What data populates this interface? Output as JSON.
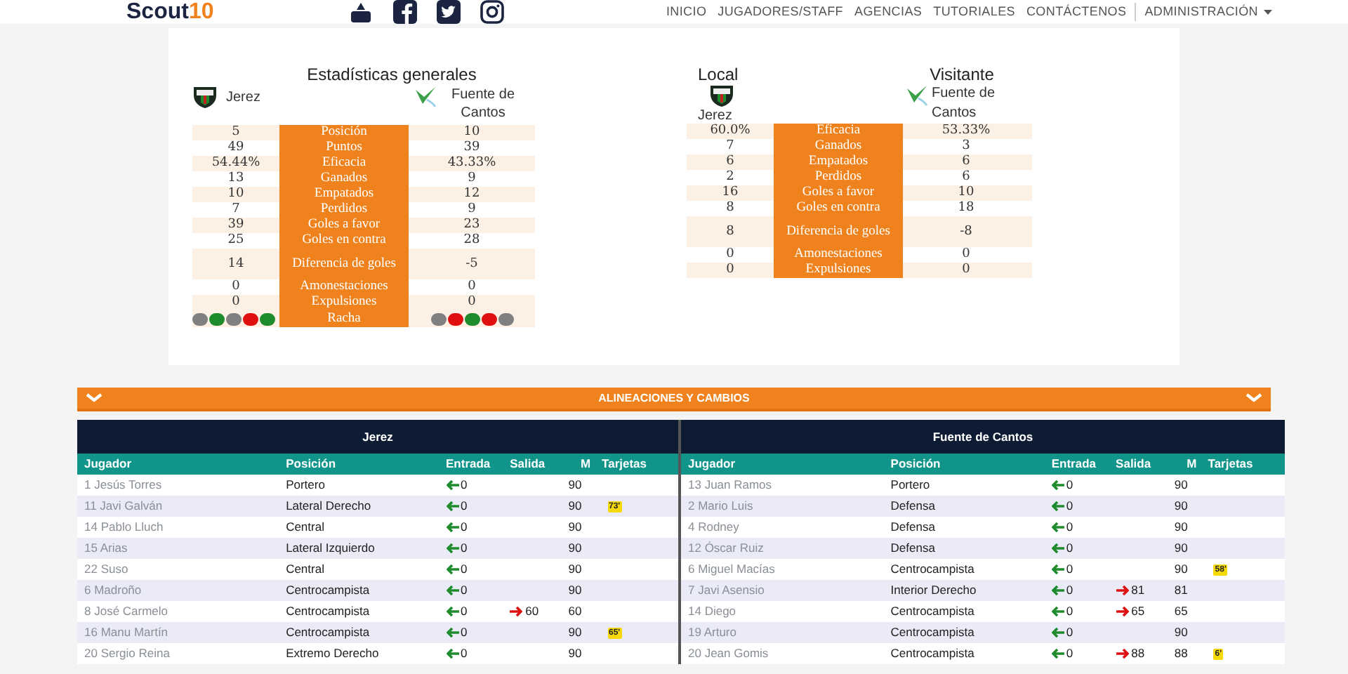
{
  "nav": {
    "logo": "Scout10",
    "links": [
      {
        "label": "INICIO"
      },
      {
        "label": "JUGADORES/STAFF"
      },
      {
        "label": "AGENCIAS"
      },
      {
        "label": "TUTORIALES"
      },
      {
        "label": "CONTÁCTENOS"
      }
    ],
    "dropdown": "ADMINISTRACIÓN"
  },
  "general": {
    "title": "Estadísticas generales",
    "home": "Jerez",
    "away": "Fuente de Cantos",
    "rows": [
      {
        "home": "5",
        "label": "Posición",
        "away": "10"
      },
      {
        "home": "49",
        "label": "Puntos",
        "away": "39"
      },
      {
        "home": "54.44%",
        "label": "Eficacia",
        "away": "43.33%"
      },
      {
        "home": "13",
        "label": "Ganados",
        "away": "9"
      },
      {
        "home": "10",
        "label": "Empatados",
        "away": "12"
      },
      {
        "home": "7",
        "label": "Perdidos",
        "away": "9"
      },
      {
        "home": "39",
        "label": "Goles a favor",
        "away": "23"
      },
      {
        "home": "25",
        "label": "Goles en contra",
        "away": "28"
      },
      {
        "home": "14",
        "label": "Diferencia de goles",
        "away": "-5"
      },
      {
        "home": "0",
        "label": "Amonestaciones",
        "away": "0"
      },
      {
        "home": "0",
        "label": "Expulsiones",
        "away": "0"
      }
    ],
    "streak": {
      "label": "Racha",
      "home": [
        {
          "color": "#808080"
        },
        {
          "color": "#1e8c2c"
        },
        {
          "color": "#808080"
        },
        {
          "color": "#e01010"
        },
        {
          "color": "#1e8c2c"
        }
      ],
      "away": [
        {
          "color": "#808080"
        },
        {
          "color": "#e01010"
        },
        {
          "color": "#1e8c2c"
        },
        {
          "color": "#e01010"
        },
        {
          "color": "#808080"
        }
      ]
    }
  },
  "split": {
    "home_heading": "Local",
    "away_heading": "Visitante",
    "home": "Jerez",
    "away": "Fuente de Cantos",
    "rows": [
      {
        "home": "60.0%",
        "label": "Eficacia",
        "away": "53.33%"
      },
      {
        "home": "7",
        "label": "Ganados",
        "away": "3"
      },
      {
        "home": "6",
        "label": "Empatados",
        "away": "6"
      },
      {
        "home": "2",
        "label": "Perdidos",
        "away": "6"
      },
      {
        "home": "16",
        "label": "Goles a favor",
        "away": "10"
      },
      {
        "home": "8",
        "label": "Goles en contra",
        "away": "18"
      },
      {
        "home": "8",
        "label": "Diferencia de goles",
        "away": "-8"
      },
      {
        "home": "0",
        "label": "Amonestaciones",
        "away": "0"
      },
      {
        "home": "0",
        "label": "Expulsiones",
        "away": "0"
      }
    ]
  },
  "lineups_bar": {
    "title": "ALINEACIONES Y CAMBIOS",
    "expanded": true
  },
  "lineups": [
    {
      "team": "Jerez",
      "columns": [
        "Jugador",
        "Posición",
        "Entrada",
        "Salida",
        "M",
        "Tarjetas"
      ],
      "rows": [
        {
          "player": "1 Jesús Torres",
          "position": "Portero",
          "in": "0",
          "out": "",
          "minutes": "90",
          "card": ""
        },
        {
          "player": "11 Javi Galván",
          "position": "Lateral Derecho",
          "in": "0",
          "out": "",
          "minutes": "90",
          "card": "73'"
        },
        {
          "player": "14 Pablo Lluch",
          "position": "Central",
          "in": "0",
          "out": "",
          "minutes": "90",
          "card": ""
        },
        {
          "player": "15 Arias",
          "position": "Lateral Izquierdo",
          "in": "0",
          "out": "",
          "minutes": "90",
          "card": ""
        },
        {
          "player": "22 Suso",
          "position": "Central",
          "in": "0",
          "out": "",
          "minutes": "90",
          "card": ""
        },
        {
          "player": "6 Madroño",
          "position": "Centrocampista",
          "in": "0",
          "out": "",
          "minutes": "90",
          "card": ""
        },
        {
          "player": "8 José Carmelo",
          "position": "Centrocampista",
          "in": "0",
          "out": "60",
          "minutes": "60",
          "card": ""
        },
        {
          "player": "16 Manu Martín",
          "position": "Centrocampista",
          "in": "0",
          "out": "",
          "minutes": "90",
          "card": "65'"
        },
        {
          "player": "20 Sergio Reina",
          "position": "Extremo Derecho",
          "in": "0",
          "out": "",
          "minutes": "90",
          "card": ""
        }
      ]
    },
    {
      "team": "Fuente de Cantos",
      "columns": [
        "Jugador",
        "Posición",
        "Entrada",
        "Salida",
        "M",
        "Tarjetas"
      ],
      "rows": [
        {
          "player": "13 Juan Ramos",
          "position": "Portero",
          "in": "0",
          "out": "",
          "minutes": "90",
          "card": ""
        },
        {
          "player": "2 Mario Luis",
          "position": "Defensa",
          "in": "0",
          "out": "",
          "minutes": "90",
          "card": ""
        },
        {
          "player": "4 Rodney",
          "position": "Defensa",
          "in": "0",
          "out": "",
          "minutes": "90",
          "card": ""
        },
        {
          "player": "12 Óscar Ruiz",
          "position": "Defensa",
          "in": "0",
          "out": "",
          "minutes": "90",
          "card": ""
        },
        {
          "player": "6 Miguel Macías",
          "position": "Centrocampista",
          "in": "0",
          "out": "",
          "minutes": "90",
          "card": "58'"
        },
        {
          "player": "7 Javi Asensio",
          "position": "Interior Derecho",
          "in": "0",
          "out": "81",
          "minutes": "81",
          "card": ""
        },
        {
          "player": "14 Diego",
          "position": "Centrocampista",
          "in": "0",
          "out": "65",
          "minutes": "65",
          "card": ""
        },
        {
          "player": "19 Arturo",
          "position": "Centrocampista",
          "in": "0",
          "out": "",
          "minutes": "90",
          "card": ""
        },
        {
          "player": "20 Jean Gomis",
          "position": "Centrocampista",
          "in": "0",
          "out": "88",
          "minutes": "88",
          "card": "6'"
        }
      ]
    }
  ]
}
